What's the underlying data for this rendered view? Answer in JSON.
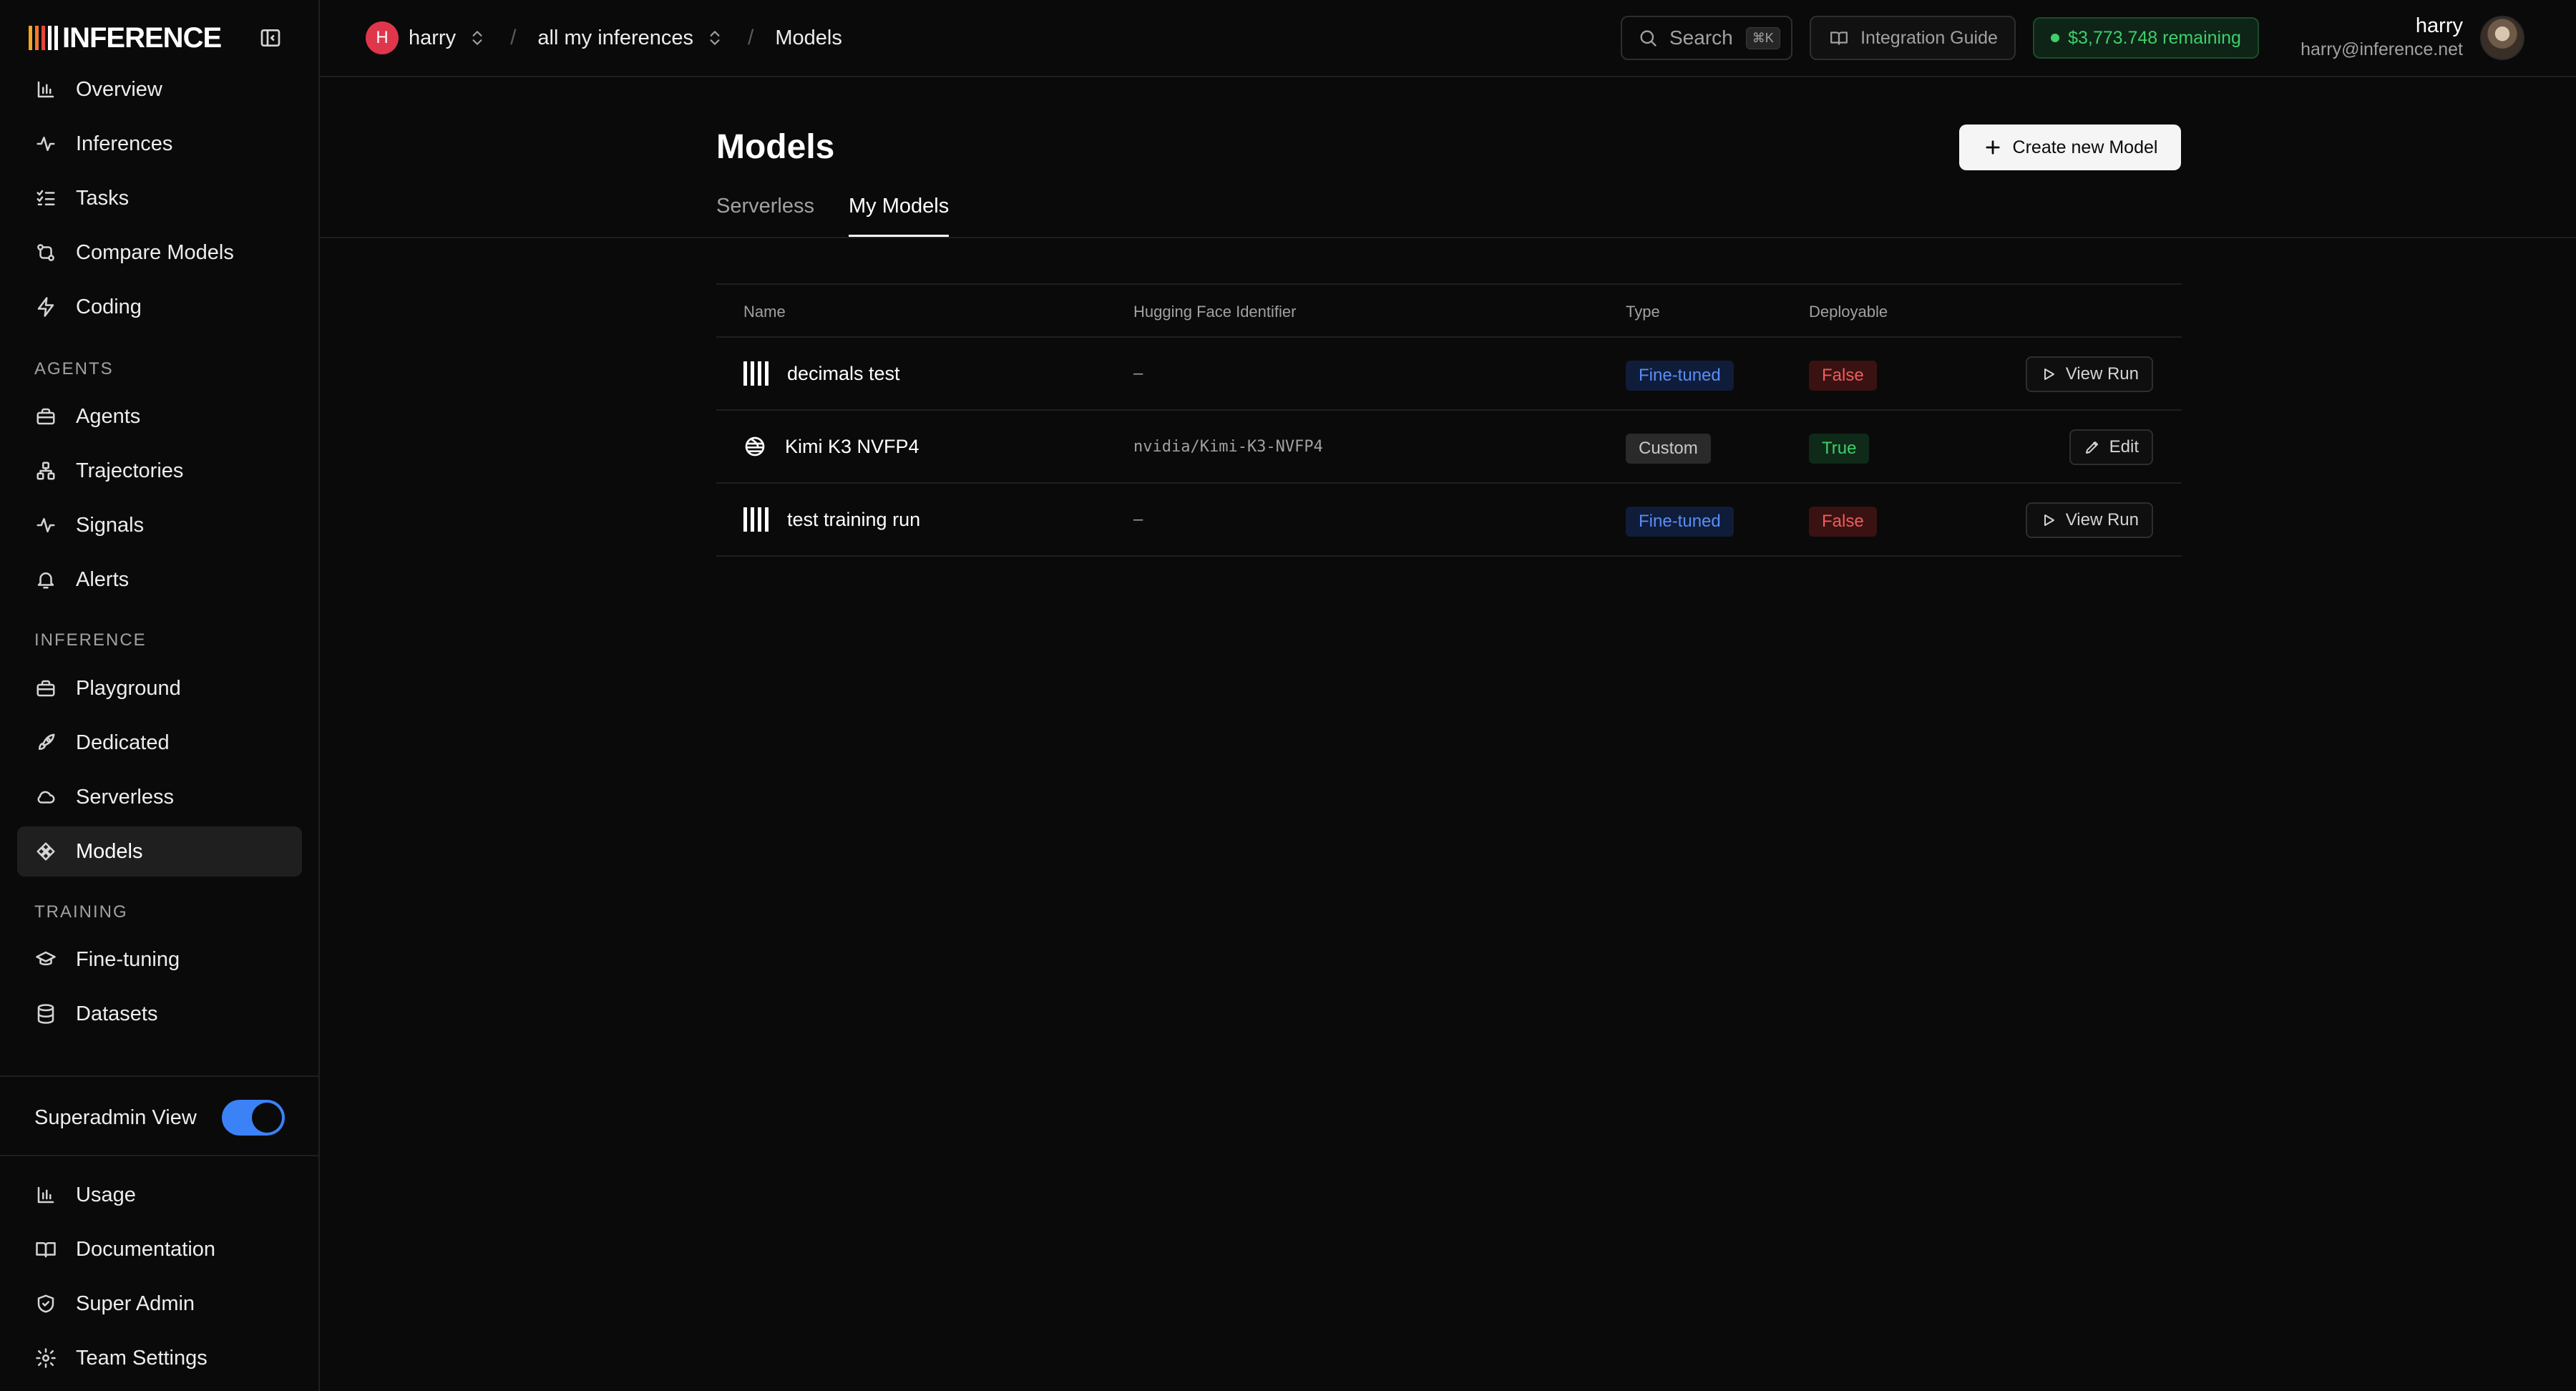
{
  "brand": {
    "name": "INFERENCE",
    "bar_colors": [
      "#f5a623",
      "#f07a2f",
      "#e8463a",
      "#ffffff",
      "#ffffff"
    ]
  },
  "sidebar": {
    "main_items": [
      {
        "label": "Overview",
        "icon": "bar-chart-icon"
      },
      {
        "label": "Inferences",
        "icon": "activity-icon"
      },
      {
        "label": "Tasks",
        "icon": "list-checks-icon"
      },
      {
        "label": "Compare Models",
        "icon": "git-compare-icon"
      },
      {
        "label": "Coding",
        "icon": "zap-icon"
      }
    ],
    "agents_label": "AGENTS",
    "agents_items": [
      {
        "label": "Agents",
        "icon": "briefcase-icon"
      },
      {
        "label": "Trajectories",
        "icon": "workflow-icon"
      },
      {
        "label": "Signals",
        "icon": "activity-icon"
      },
      {
        "label": "Alerts",
        "icon": "bell-icon"
      }
    ],
    "inference_label": "INFERENCE",
    "inference_items": [
      {
        "label": "Playground",
        "icon": "briefcase-icon"
      },
      {
        "label": "Dedicated",
        "icon": "rocket-icon"
      },
      {
        "label": "Serverless",
        "icon": "cloud-icon"
      },
      {
        "label": "Models",
        "icon": "models-icon",
        "active": true
      }
    ],
    "training_label": "TRAINING",
    "training_items": [
      {
        "label": "Fine-tuning",
        "icon": "graduation-cap-icon"
      },
      {
        "label": "Datasets",
        "icon": "database-icon"
      }
    ],
    "superadmin_label": "Superadmin View",
    "superadmin_on": true,
    "bottom_items": [
      {
        "label": "Usage",
        "icon": "bar-chart-icon"
      },
      {
        "label": "Documentation",
        "icon": "book-icon"
      },
      {
        "label": "Super Admin",
        "icon": "shield-icon"
      },
      {
        "label": "Team Settings",
        "icon": "gear-icon"
      }
    ]
  },
  "header": {
    "team_initial": "H",
    "team_name": "harry",
    "project_name": "all my inferences",
    "page_name": "Models",
    "sep": "/",
    "search_label": "Search",
    "search_shortcut": "⌘K",
    "guide_label": "Integration Guide",
    "credits": "$3,773.748 remaining",
    "user_name": "harry",
    "user_email": "harry@inference.net"
  },
  "main": {
    "title": "Models",
    "create_label": "Create new Model",
    "tabs": [
      {
        "label": "Serverless",
        "active": false
      },
      {
        "label": "My Models",
        "active": true
      }
    ],
    "columns": {
      "name": "Name",
      "hf": "Hugging Face Identifier",
      "type": "Type",
      "deployable": "Deployable"
    },
    "rows": [
      {
        "name": "decimals test",
        "icon": "bars-icon",
        "hf": "–",
        "type": "Fine-tuned",
        "deployable": "False",
        "action": "View Run",
        "action_icon": "play-icon"
      },
      {
        "name": "Kimi K3 NVFP4",
        "icon": "globe-icon",
        "hf": "nvidia/Kimi-K3-NVFP4",
        "type": "Custom",
        "deployable": "True",
        "action": "Edit",
        "action_icon": "pencil-icon"
      },
      {
        "name": "test training run",
        "icon": "bars-icon",
        "hf": "–",
        "type": "Fine-tuned",
        "deployable": "False",
        "action": "View Run",
        "action_icon": "play-icon"
      }
    ]
  }
}
